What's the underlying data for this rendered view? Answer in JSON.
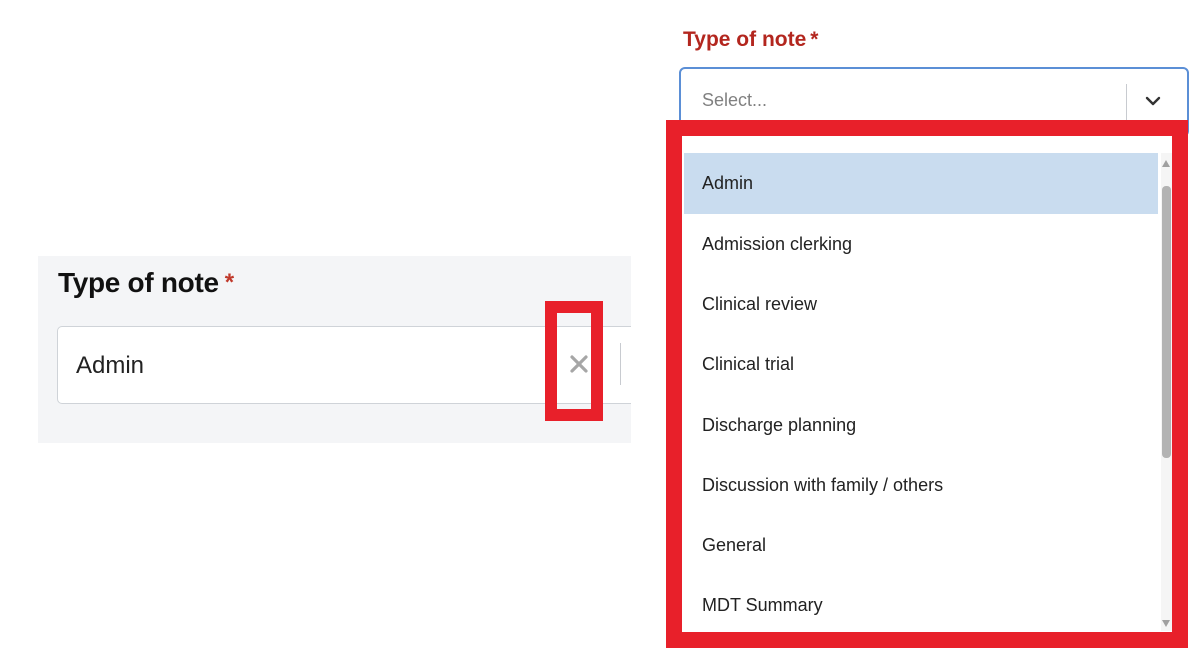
{
  "left_field": {
    "label": "Type of note",
    "required_mark": "*",
    "value": "Admin"
  },
  "right_field": {
    "label": "Type of note",
    "required_mark": "*",
    "placeholder": "Select...",
    "options": [
      "Admin",
      "Admission clerking",
      "Clinical review",
      "Clinical trial",
      "Discharge planning",
      "Discussion with family / others",
      "General",
      "MDT Summary"
    ],
    "highlighted_option": "Admin"
  },
  "icons": {
    "clear": "close-icon",
    "dropdown": "chevron-down-icon"
  },
  "colors": {
    "highlight_box": "#e8202a",
    "required_asterisk": "#c0392b",
    "right_label": "#b3261e",
    "focus_border": "#5b8fd6",
    "active_option_bg": "#c9dcef"
  }
}
